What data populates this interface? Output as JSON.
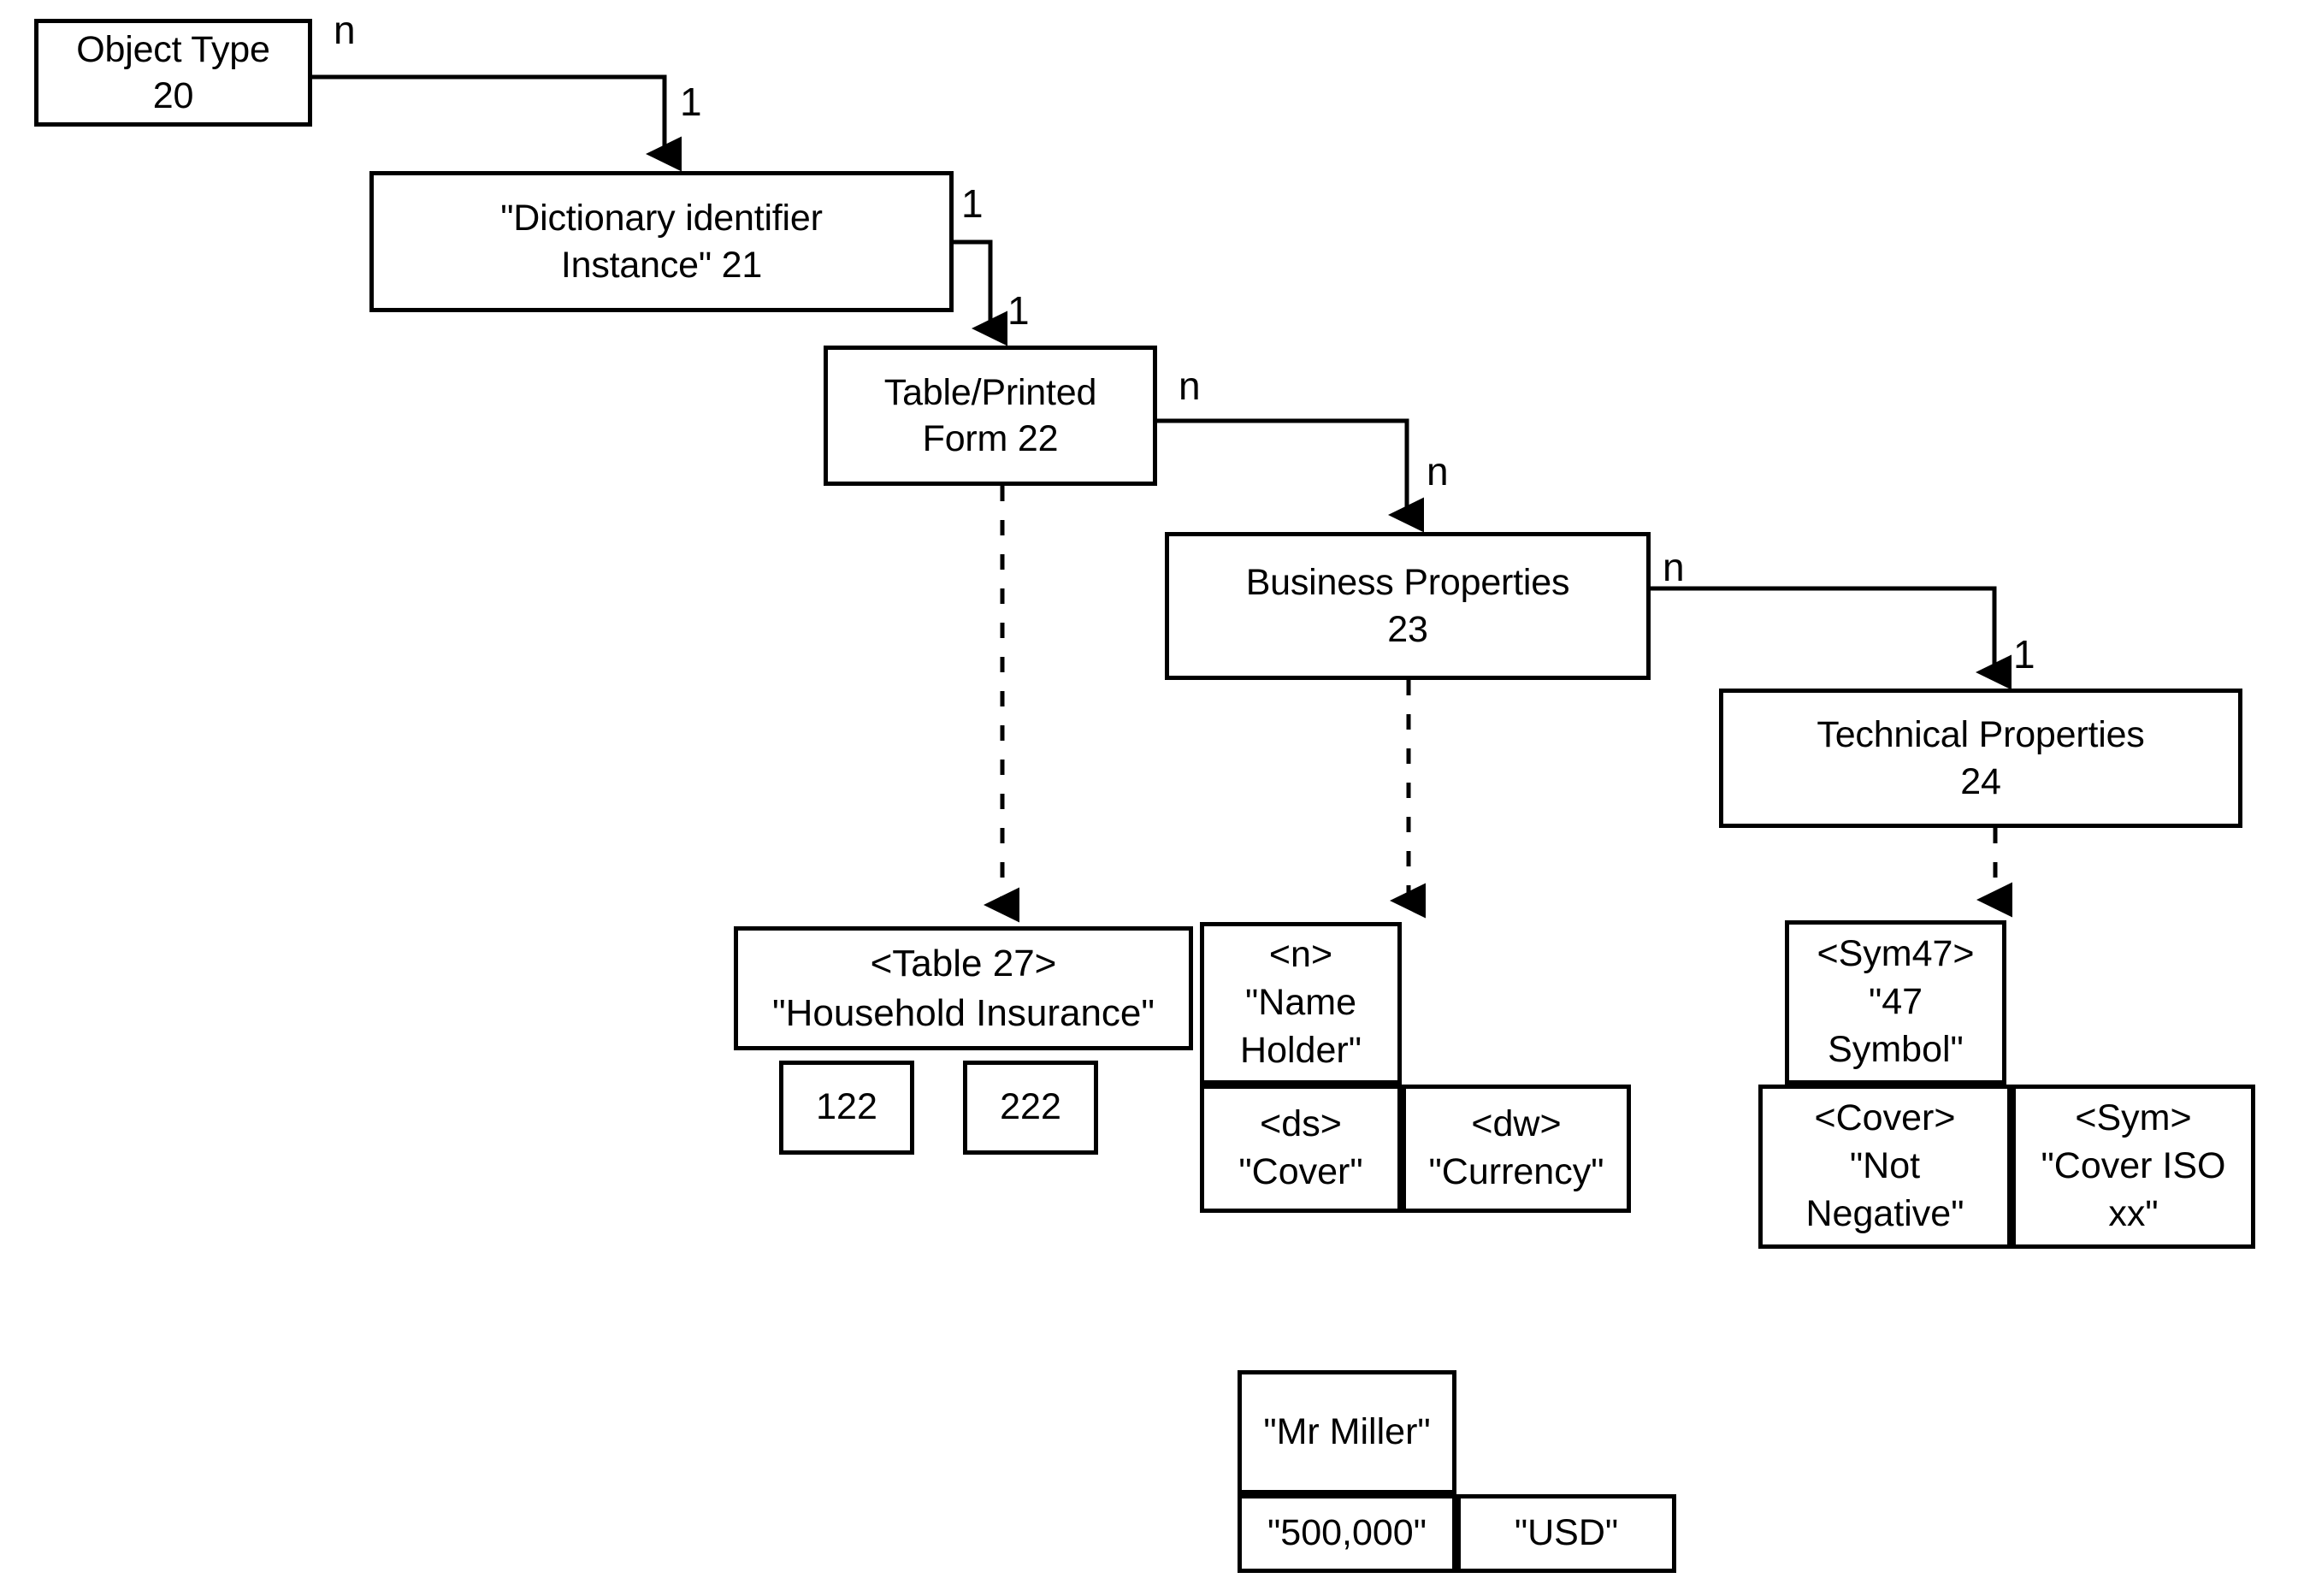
{
  "diagram": {
    "nodes": {
      "object_type": "Object Type\n20",
      "dictionary_identifier_instance": "\"Dictionary identifier\nInstance\" 21",
      "table_printed_form": "Table/Printed\nForm 22",
      "business_properties": "Business Properties\n23",
      "technical_properties": "Technical Properties\n24"
    },
    "cardinalities": {
      "object_type_out": "n",
      "dictionary_in": "1",
      "dictionary_out": "1",
      "table_form_in": "1",
      "table_form_out": "n",
      "business_in": "n",
      "business_out": "n",
      "technical_in": "1"
    },
    "instance_groups": {
      "table27": {
        "header": "<Table 27>\n\"Household Insurance\"",
        "cells": [
          "122",
          "222"
        ]
      },
      "name_holder": {
        "header": "<n>\n\"Name\nHolder\"",
        "cells": [
          "<ds>\n\"Cover\"",
          "<dw>\n\"Currency\""
        ]
      },
      "sym47": {
        "header": "<Sym47>\n\"47\nSymbol\"",
        "cells": [
          "<Cover>\n\"Not\nNegative\"",
          "<Sym>\n\"Cover ISO\nxx\""
        ]
      },
      "values": {
        "header": "\"Mr Miller\"",
        "cells": [
          "\"500,000\"",
          "\"USD\""
        ]
      }
    }
  }
}
